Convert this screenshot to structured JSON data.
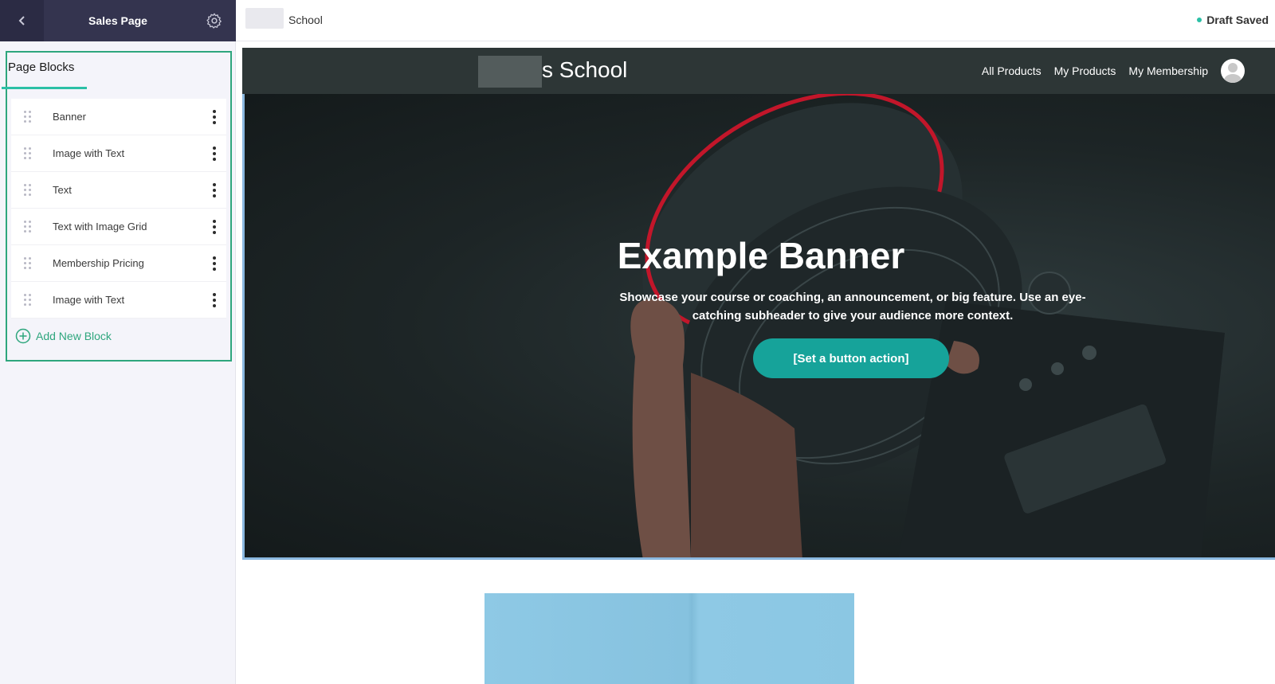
{
  "sidebar": {
    "title": "Sales Page",
    "panel_heading": "Page Blocks",
    "blocks": [
      {
        "label": "Banner"
      },
      {
        "label": "Image with Text"
      },
      {
        "label": "Text"
      },
      {
        "label": "Text with Image Grid"
      },
      {
        "label": "Membership Pricing"
      },
      {
        "label": "Image with Text"
      }
    ],
    "add_block_label": "Add New Block"
  },
  "topbar": {
    "school_name": "School",
    "status": "Draft Saved"
  },
  "preview": {
    "site_logo": "s School",
    "nav_links": [
      "All Products",
      "My Products",
      "My Membership"
    ],
    "banner": {
      "title": "Example Banner",
      "subtitle": "Showcase your course or coaching, an announcement, or big feature. Use an eye-catching subheader to give your audience more context.",
      "button_label": "[Set a button action]"
    }
  },
  "colors": {
    "sidebar_header": "#34344f",
    "accent_green": "#2ea67d",
    "button_teal": "#16a39a",
    "site_nav": "#2d3636"
  }
}
